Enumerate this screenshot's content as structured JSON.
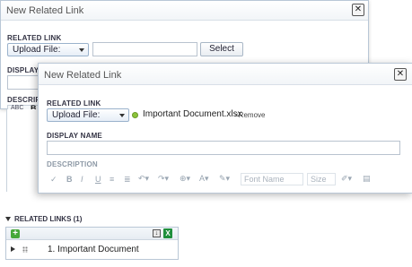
{
  "back_dialog": {
    "title": "New Related Link",
    "close_glyph": "✕",
    "related_link_label": "RELATED LINK",
    "upload_select_value": "Upload File:",
    "select_button_label": "Select",
    "display_label_partial": "DISPLAY N",
    "description_label_partial": "DESCRIPTI",
    "toolbar_bold": "B"
  },
  "front_dialog": {
    "title": "New Related Link",
    "close_glyph": "✕",
    "related_link_label": "RELATED LINK",
    "upload_select_value": "Upload File:",
    "file_name": "Important Document.xlsx",
    "remove_label": "×Remove",
    "display_name_label": "DISPLAY NAME",
    "description_label": "DESCRIPTION",
    "toolbar": {
      "font_name_placeholder": "Font Name",
      "size_placeholder": "Size"
    }
  },
  "related_links": {
    "header": "RELATED LINKS (1)",
    "items": [
      {
        "label": "1. Important Document"
      }
    ]
  },
  "colors": {
    "accent_border": "#b9c7d6",
    "upload_indicator": "#8bc33a",
    "excel_green": "#1f8f3c",
    "add_green": "#46a83a"
  },
  "icons": [
    "close-icon",
    "chevron-down-icon",
    "spellcheck-icon",
    "bold-icon",
    "italic-icon",
    "underline-icon",
    "undo-icon",
    "redo-icon",
    "link-icon",
    "font-color-icon",
    "highlight-icon",
    "brush-icon",
    "add-icon",
    "download-icon",
    "excel-icon",
    "expand-icon",
    "drag-handle-icon"
  ]
}
